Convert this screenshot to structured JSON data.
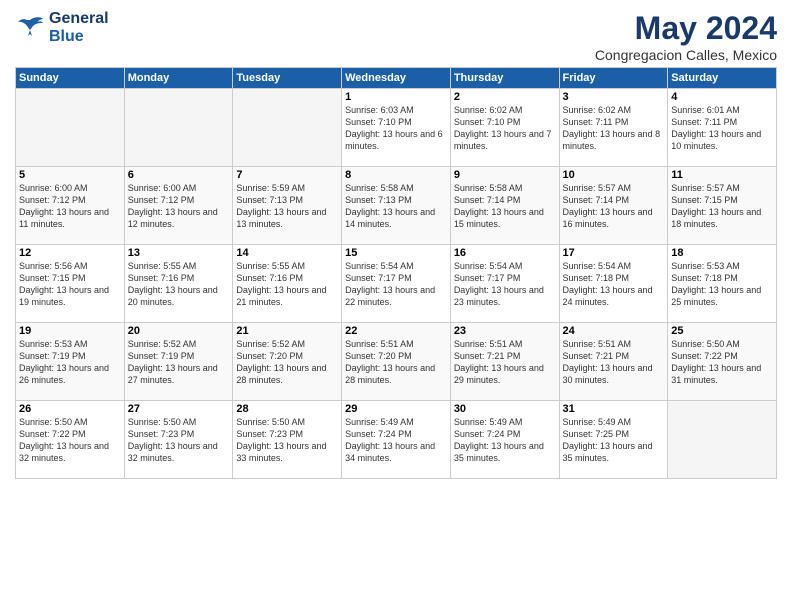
{
  "header": {
    "logo_line1": "General",
    "logo_line2": "Blue",
    "month": "May 2024",
    "location": "Congregacion Calles, Mexico"
  },
  "weekdays": [
    "Sunday",
    "Monday",
    "Tuesday",
    "Wednesday",
    "Thursday",
    "Friday",
    "Saturday"
  ],
  "weeks": [
    [
      {
        "day": "",
        "sunrise": "",
        "sunset": "",
        "daylight": ""
      },
      {
        "day": "",
        "sunrise": "",
        "sunset": "",
        "daylight": ""
      },
      {
        "day": "",
        "sunrise": "",
        "sunset": "",
        "daylight": ""
      },
      {
        "day": "1",
        "sunrise": "Sunrise: 6:03 AM",
        "sunset": "Sunset: 7:10 PM",
        "daylight": "Daylight: 13 hours and 6 minutes."
      },
      {
        "day": "2",
        "sunrise": "Sunrise: 6:02 AM",
        "sunset": "Sunset: 7:10 PM",
        "daylight": "Daylight: 13 hours and 7 minutes."
      },
      {
        "day": "3",
        "sunrise": "Sunrise: 6:02 AM",
        "sunset": "Sunset: 7:11 PM",
        "daylight": "Daylight: 13 hours and 8 minutes."
      },
      {
        "day": "4",
        "sunrise": "Sunrise: 6:01 AM",
        "sunset": "Sunset: 7:11 PM",
        "daylight": "Daylight: 13 hours and 10 minutes."
      }
    ],
    [
      {
        "day": "5",
        "sunrise": "Sunrise: 6:00 AM",
        "sunset": "Sunset: 7:12 PM",
        "daylight": "Daylight: 13 hours and 11 minutes."
      },
      {
        "day": "6",
        "sunrise": "Sunrise: 6:00 AM",
        "sunset": "Sunset: 7:12 PM",
        "daylight": "Daylight: 13 hours and 12 minutes."
      },
      {
        "day": "7",
        "sunrise": "Sunrise: 5:59 AM",
        "sunset": "Sunset: 7:13 PM",
        "daylight": "Daylight: 13 hours and 13 minutes."
      },
      {
        "day": "8",
        "sunrise": "Sunrise: 5:58 AM",
        "sunset": "Sunset: 7:13 PM",
        "daylight": "Daylight: 13 hours and 14 minutes."
      },
      {
        "day": "9",
        "sunrise": "Sunrise: 5:58 AM",
        "sunset": "Sunset: 7:14 PM",
        "daylight": "Daylight: 13 hours and 15 minutes."
      },
      {
        "day": "10",
        "sunrise": "Sunrise: 5:57 AM",
        "sunset": "Sunset: 7:14 PM",
        "daylight": "Daylight: 13 hours and 16 minutes."
      },
      {
        "day": "11",
        "sunrise": "Sunrise: 5:57 AM",
        "sunset": "Sunset: 7:15 PM",
        "daylight": "Daylight: 13 hours and 18 minutes."
      }
    ],
    [
      {
        "day": "12",
        "sunrise": "Sunrise: 5:56 AM",
        "sunset": "Sunset: 7:15 PM",
        "daylight": "Daylight: 13 hours and 19 minutes."
      },
      {
        "day": "13",
        "sunrise": "Sunrise: 5:55 AM",
        "sunset": "Sunset: 7:16 PM",
        "daylight": "Daylight: 13 hours and 20 minutes."
      },
      {
        "day": "14",
        "sunrise": "Sunrise: 5:55 AM",
        "sunset": "Sunset: 7:16 PM",
        "daylight": "Daylight: 13 hours and 21 minutes."
      },
      {
        "day": "15",
        "sunrise": "Sunrise: 5:54 AM",
        "sunset": "Sunset: 7:17 PM",
        "daylight": "Daylight: 13 hours and 22 minutes."
      },
      {
        "day": "16",
        "sunrise": "Sunrise: 5:54 AM",
        "sunset": "Sunset: 7:17 PM",
        "daylight": "Daylight: 13 hours and 23 minutes."
      },
      {
        "day": "17",
        "sunrise": "Sunrise: 5:54 AM",
        "sunset": "Sunset: 7:18 PM",
        "daylight": "Daylight: 13 hours and 24 minutes."
      },
      {
        "day": "18",
        "sunrise": "Sunrise: 5:53 AM",
        "sunset": "Sunset: 7:18 PM",
        "daylight": "Daylight: 13 hours and 25 minutes."
      }
    ],
    [
      {
        "day": "19",
        "sunrise": "Sunrise: 5:53 AM",
        "sunset": "Sunset: 7:19 PM",
        "daylight": "Daylight: 13 hours and 26 minutes."
      },
      {
        "day": "20",
        "sunrise": "Sunrise: 5:52 AM",
        "sunset": "Sunset: 7:19 PM",
        "daylight": "Daylight: 13 hours and 27 minutes."
      },
      {
        "day": "21",
        "sunrise": "Sunrise: 5:52 AM",
        "sunset": "Sunset: 7:20 PM",
        "daylight": "Daylight: 13 hours and 28 minutes."
      },
      {
        "day": "22",
        "sunrise": "Sunrise: 5:51 AM",
        "sunset": "Sunset: 7:20 PM",
        "daylight": "Daylight: 13 hours and 28 minutes."
      },
      {
        "day": "23",
        "sunrise": "Sunrise: 5:51 AM",
        "sunset": "Sunset: 7:21 PM",
        "daylight": "Daylight: 13 hours and 29 minutes."
      },
      {
        "day": "24",
        "sunrise": "Sunrise: 5:51 AM",
        "sunset": "Sunset: 7:21 PM",
        "daylight": "Daylight: 13 hours and 30 minutes."
      },
      {
        "day": "25",
        "sunrise": "Sunrise: 5:50 AM",
        "sunset": "Sunset: 7:22 PM",
        "daylight": "Daylight: 13 hours and 31 minutes."
      }
    ],
    [
      {
        "day": "26",
        "sunrise": "Sunrise: 5:50 AM",
        "sunset": "Sunset: 7:22 PM",
        "daylight": "Daylight: 13 hours and 32 minutes."
      },
      {
        "day": "27",
        "sunrise": "Sunrise: 5:50 AM",
        "sunset": "Sunset: 7:23 PM",
        "daylight": "Daylight: 13 hours and 32 minutes."
      },
      {
        "day": "28",
        "sunrise": "Sunrise: 5:50 AM",
        "sunset": "Sunset: 7:23 PM",
        "daylight": "Daylight: 13 hours and 33 minutes."
      },
      {
        "day": "29",
        "sunrise": "Sunrise: 5:49 AM",
        "sunset": "Sunset: 7:24 PM",
        "daylight": "Daylight: 13 hours and 34 minutes."
      },
      {
        "day": "30",
        "sunrise": "Sunrise: 5:49 AM",
        "sunset": "Sunset: 7:24 PM",
        "daylight": "Daylight: 13 hours and 35 minutes."
      },
      {
        "day": "31",
        "sunrise": "Sunrise: 5:49 AM",
        "sunset": "Sunset: 7:25 PM",
        "daylight": "Daylight: 13 hours and 35 minutes."
      },
      {
        "day": "",
        "sunrise": "",
        "sunset": "",
        "daylight": ""
      }
    ]
  ]
}
